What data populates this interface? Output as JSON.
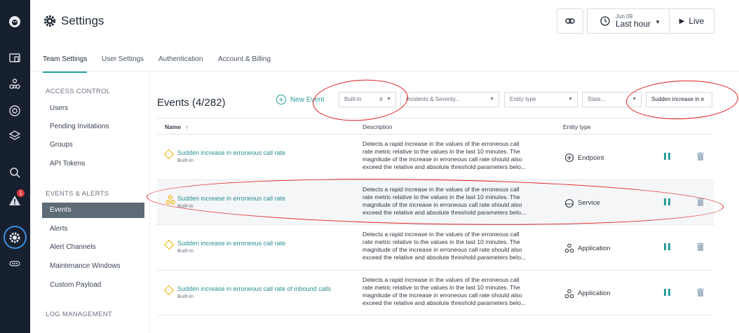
{
  "header": {
    "title": "Settings",
    "time": {
      "date": "Jun 09",
      "range": "Last hour"
    },
    "live_label": "Live"
  },
  "tabs": [
    {
      "label": "Team Settings",
      "active": true
    },
    {
      "label": "User Settings",
      "active": false
    },
    {
      "label": "Authentication",
      "active": false
    },
    {
      "label": "Account & Billing",
      "active": false
    }
  ],
  "sidebar": {
    "sections": [
      {
        "title": "ACCESS CONTROL",
        "items": [
          "Users",
          "Pending Invitations",
          "Groups",
          "API Tokens"
        ]
      },
      {
        "title": "EVENTS & ALERTS",
        "items": [
          "Events",
          "Alerts",
          "Alert Channels",
          "Maintenance Windows",
          "Custom Payload"
        ]
      },
      {
        "title": "LOG MANAGEMENT",
        "items": []
      }
    ],
    "active_item": "Events"
  },
  "rail": {
    "alert_badge": "1"
  },
  "events": {
    "title": "Events (4/282)",
    "new_event_label": "New Event",
    "filters": {
      "type": "Built-in",
      "type_clear": "x",
      "incidents": "Incidents & Severity...",
      "entity_type": "Entity type",
      "state": "State...",
      "search": "Sudden increase in e"
    },
    "columns": {
      "name": "Name",
      "sort_arrow": "↑",
      "description": "Description",
      "entity_type": "Entity type"
    },
    "rows": [
      {
        "name": "Sudden increase in erroneous call rate",
        "source": "Built-in",
        "icon": "diamond-warning-icon",
        "desc": [
          "Detects a rapid increase in the values of the erroneous call",
          "rate metric relative to the values in the last 10 minutes. The",
          "magnitude of the increase in erroneous call rate should also",
          "exceed the relative and absolute threshold parameters belo..."
        ],
        "entity": "Endpoint",
        "entity_icon": "endpoint-icon"
      },
      {
        "name": "Sudden increase in erroneous call rate",
        "source": "Built-in",
        "icon": "hierarchy-icon",
        "desc": [
          "Detects a rapid increase in the values of the erroneous call",
          "rate metric relative to the values in the last 10 minutes. The",
          "magnitude of the increase in erroneous call rate should also",
          "exceed the relative and absolute threshold parameters belo..."
        ],
        "entity": "Service",
        "entity_icon": "service-icon"
      },
      {
        "name": "Sudden increase in erroneous call rate",
        "source": "Built-in",
        "icon": "diamond-warning-icon",
        "desc": [
          "Detects a rapid increase in the values of the erroneous call",
          "rate metric relative to the values in the last 10 minutes. The",
          "magnitude of the increase in erroneous call rate should also",
          "exceed the relative and absolute threshold parameters belo..."
        ],
        "entity": "Application",
        "entity_icon": "application-icon"
      },
      {
        "name": "Sudden increase in erroneous call rate of inbound calls",
        "source": "Built-in",
        "icon": "diamond-warning-icon",
        "desc": [
          "Detects a rapid increase in the values of the erroneous call",
          "rate metric relative to the values in the last 10 minutes. The",
          "magnitude of the increase in erroneous call rate should also",
          "exceed the relative and absolute threshold parameters belo..."
        ],
        "entity": "Application",
        "entity_icon": "application-icon"
      }
    ]
  },
  "colors": {
    "accent": "#2aa3a0",
    "rail": "#17202e",
    "annotation": "#e02020",
    "warning": "#f0b400"
  }
}
